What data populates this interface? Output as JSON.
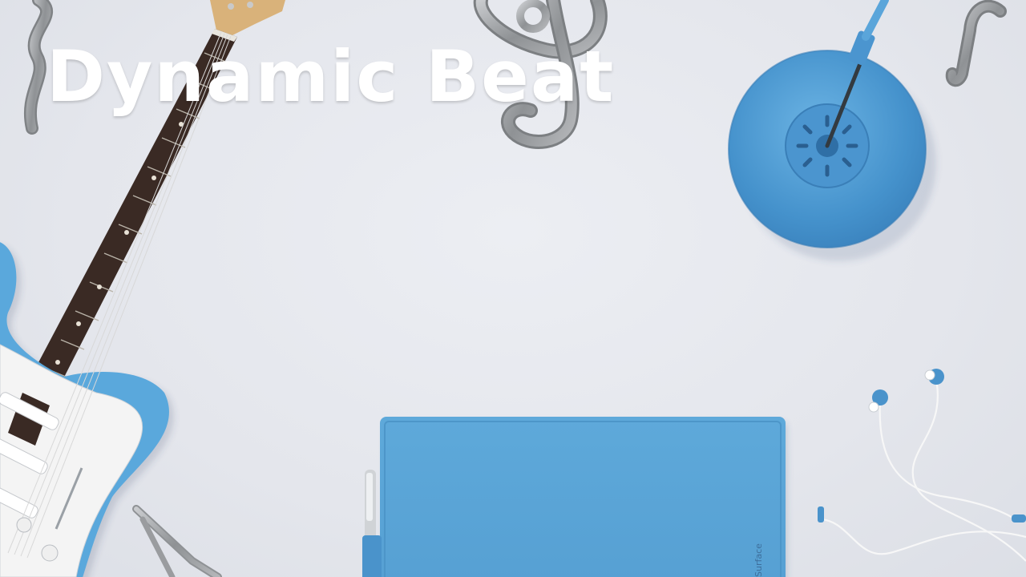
{
  "game": {
    "title": "Dynamic Beat",
    "tablet_brand": "Surface"
  },
  "colors": {
    "background": "#e6e7ed",
    "accent_blue": "#56a3d6",
    "title_text": "#ffffff",
    "metal_silver": "#9a9c9f"
  },
  "props": [
    "electric-guitar-icon",
    "treble-clef-icon",
    "forte-f-icon",
    "desk-lamp-icon",
    "tablet-icon",
    "earphones-icon",
    "wavy-rest-icon"
  ]
}
